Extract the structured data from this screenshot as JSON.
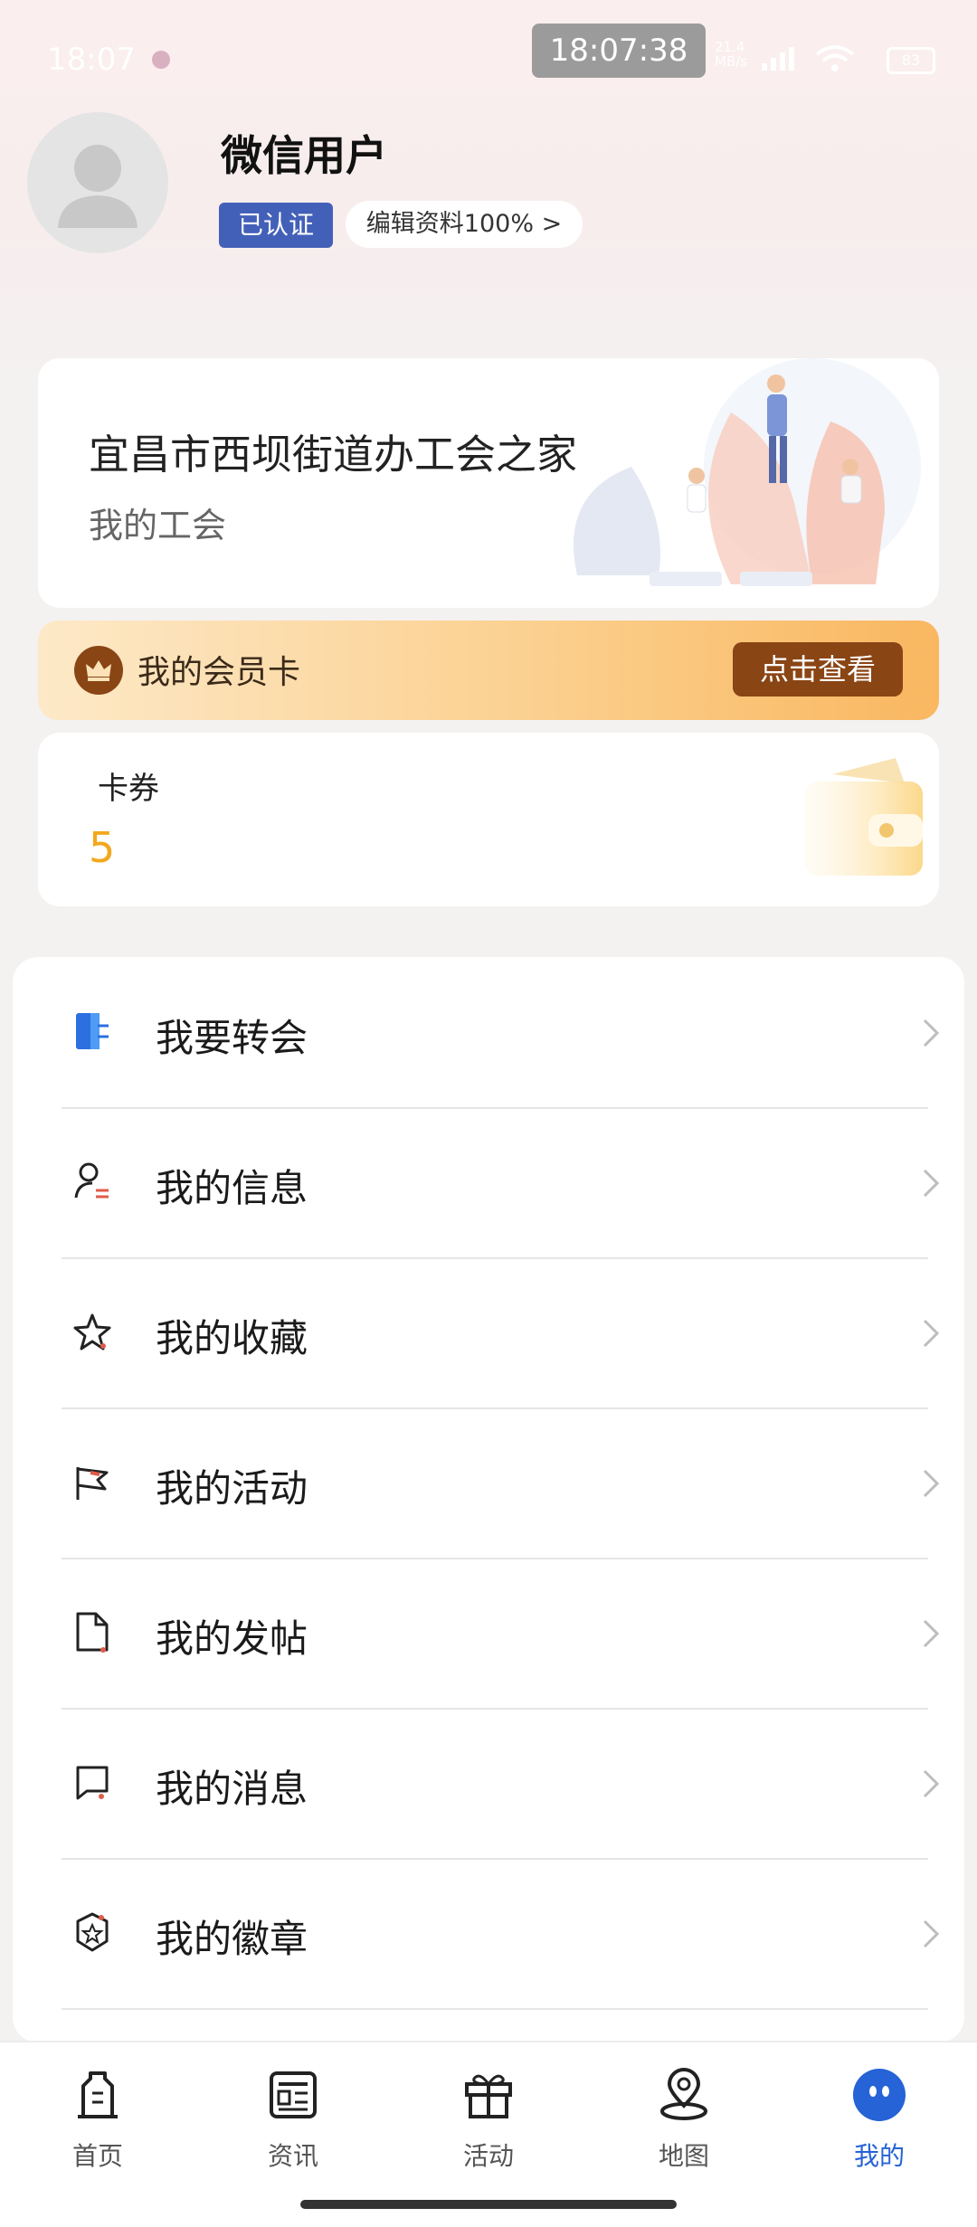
{
  "status_bar": {
    "time": "18:07",
    "clock_overlay": "18:07:38",
    "net_speed": "21.4\nMB/s",
    "battery": "83"
  },
  "profile": {
    "username": "微信用户",
    "verified": "已认证",
    "edit_profile": "编辑资料100%  >"
  },
  "union": {
    "title": "宜昌市西坝街道办工会之家",
    "subtitle": "我的工会"
  },
  "member_card": {
    "label": "我的会员卡",
    "button": "点击查看"
  },
  "coupons": {
    "label": "卡券",
    "count": "5"
  },
  "menu": [
    {
      "label": "我要转会",
      "icon": "transfer-icon"
    },
    {
      "label": "我的信息",
      "icon": "user-info-icon"
    },
    {
      "label": "我的收藏",
      "icon": "star-icon"
    },
    {
      "label": "我的活动",
      "icon": "flag-icon"
    },
    {
      "label": "我的发帖",
      "icon": "document-icon"
    },
    {
      "label": "我的消息",
      "icon": "message-icon"
    },
    {
      "label": "我的徽章",
      "icon": "badge-icon"
    }
  ],
  "tabbar": [
    {
      "label": "首页",
      "icon": "home-icon"
    },
    {
      "label": "资讯",
      "icon": "news-icon"
    },
    {
      "label": "活动",
      "icon": "gift-icon"
    },
    {
      "label": "地图",
      "icon": "map-pin-icon"
    },
    {
      "label": "我的",
      "icon": "profile-face-icon",
      "active": true
    }
  ],
  "colors": {
    "accent": "#2563d6",
    "verified_badge": "#4360b9",
    "member_button": "#8a4515",
    "coupon_count": "#f2a81d"
  }
}
